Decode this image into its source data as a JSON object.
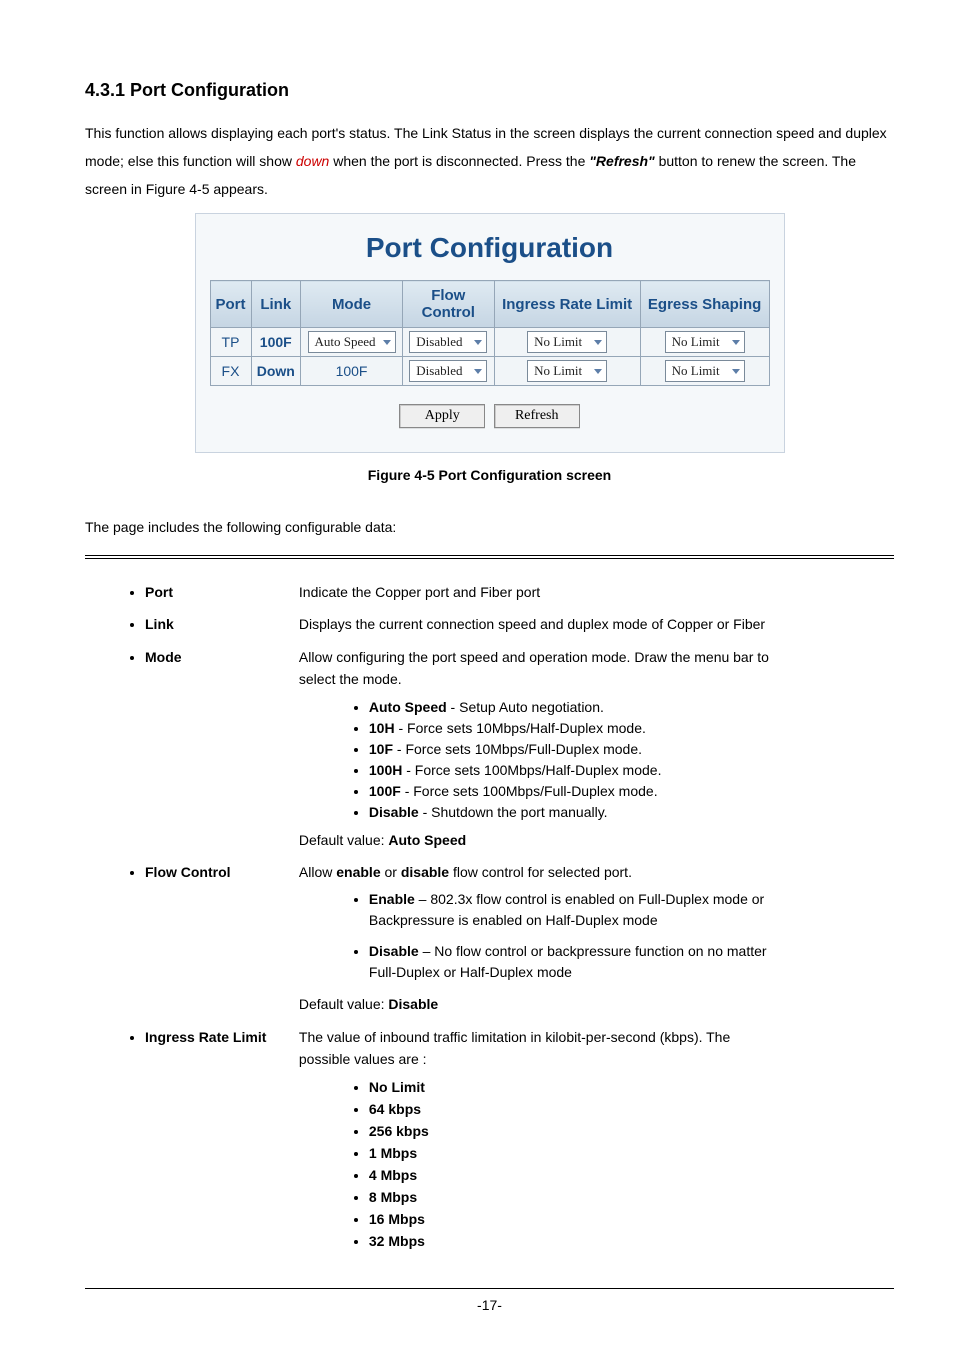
{
  "section_title": "4.3.1 Port Configuration",
  "intro_a": "This function allows displaying each port's status. The Link Status in the screen displays the current connection speed and duplex mode; else this function will show ",
  "intro_red": "down",
  "intro_b": " when the port is disconnected. Press the ",
  "intro_btn": "\"Refresh\"",
  "intro_c": " button to renew the screen. The screen in Figure 4-5 appears.",
  "panel": {
    "title": "Port Configuration",
    "headers": [
      "Port",
      "Link",
      "Mode",
      "Flow Control",
      "Ingress Rate Limit",
      "Egress Shaping"
    ],
    "rows": [
      {
        "port": "TP",
        "link": "100F",
        "link_cls": "link-on",
        "mode": "Auto Speed",
        "mode_dd": true,
        "flow": "Disabled",
        "ingress": "No Limit",
        "egress": "No Limit"
      },
      {
        "port": "FX",
        "link": "Down",
        "link_cls": "link-off",
        "mode": "100F",
        "mode_dd": false,
        "flow": "Disabled",
        "ingress": "No Limit",
        "egress": "No Limit"
      }
    ],
    "btn_apply": "Apply",
    "btn_refresh": "Refresh"
  },
  "caption_a": "Figure 4-5",
  "caption_b": " Port Configuration screen",
  "lead": "The page includes the following configurable data:",
  "spec": {
    "port": {
      "label": "Port",
      "desc": "Indicate the Copper port and Fiber port"
    },
    "link": {
      "label": "Link",
      "desc": "Displays the current connection speed and duplex mode of Copper or Fiber"
    },
    "mode": {
      "label": "Mode",
      "desc": "Allow configuring the port speed and operation mode. Draw the menu bar to select the mode.",
      "opts": [
        {
          "k": "Auto Speed",
          "d": " - Setup Auto negotiation."
        },
        {
          "k": "10H",
          "d": " - Force sets 10Mbps/Half-Duplex mode."
        },
        {
          "k": "10F",
          "d": " - Force sets 10Mbps/Full-Duplex mode."
        },
        {
          "k": "100H",
          "d": " - Force sets 100Mbps/Half-Duplex mode."
        },
        {
          "k": "100F",
          "d": " - Force sets 100Mbps/Full-Duplex mode."
        },
        {
          "k": "Disable",
          "d": " - Shutdown the port manually."
        }
      ],
      "default_a": "Default  value: ",
      "default_b": "Auto Speed"
    },
    "flow": {
      "label": "Flow Control",
      "desc_a": "Allow ",
      "desc_b": "enable",
      "desc_c": " or ",
      "desc_d": "disable",
      "desc_e": " flow control for selected port.",
      "opts": [
        {
          "k": "Enable",
          "d": " – 802.3x flow control is enabled on Full-Duplex mode or Backpressure is enabled on Half-Duplex mode"
        },
        {
          "k": "Disable",
          "d": " – No flow control or backpressure function on no matter Full-Duplex or Half-Duplex mode"
        }
      ],
      "default_a": "Default  value: ",
      "default_b": "Disable"
    },
    "ingress": {
      "label": "Ingress Rate Limit",
      "desc": "The value of inbound traffic limitation in kilobit-per-second (kbps). The possible values are :",
      "vals": [
        "No Limit",
        "64 kbps",
        "256 kbps",
        "1 Mbps",
        "4 Mbps",
        "8 Mbps",
        "16 Mbps",
        "32 Mbps"
      ]
    }
  },
  "page_no": "-17-"
}
